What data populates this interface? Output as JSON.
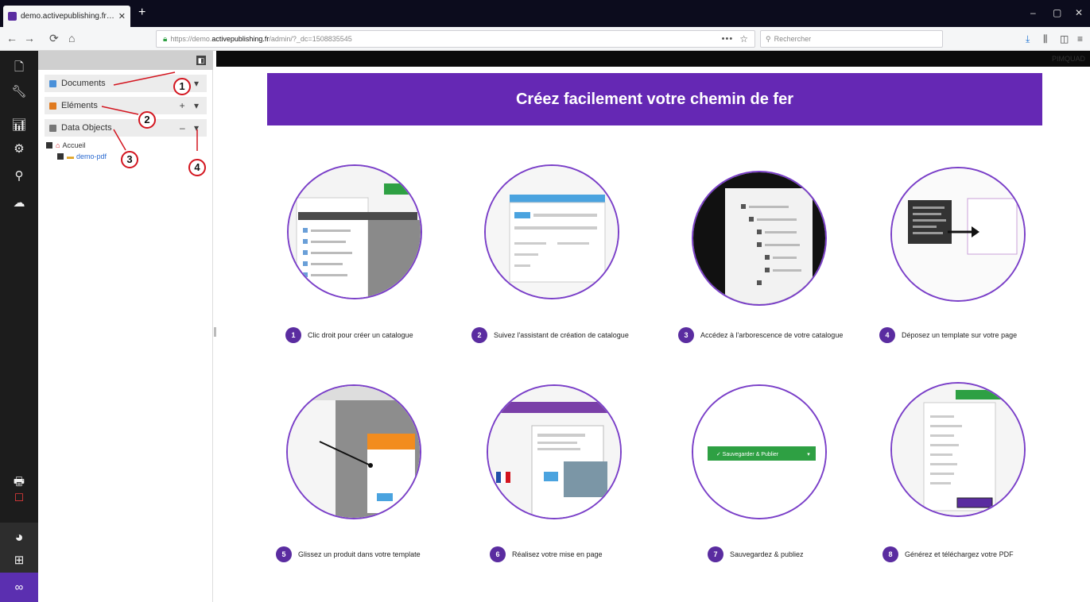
{
  "browser": {
    "tab_title": "demo.activepublishing.fr | P...",
    "tab_close": "✕",
    "new_tab": "+",
    "back": "←",
    "forward": "→",
    "reload": "⟳",
    "home": "⌂",
    "url_prefix": "https://demo.",
    "url_domain": "activepublishing.fr",
    "url_rest": "/admin/?_dc=1508835545",
    "url_actions": "•••",
    "search_placeholder": "Rechercher",
    "minimize": "–",
    "maximize": "▢",
    "close": "✕"
  },
  "sidebar": {
    "collapse_label": "◧",
    "sections": [
      {
        "label": "Documents",
        "controls": "+ ▾",
        "color": "#4a90d9"
      },
      {
        "label": "Eléments",
        "controls": "+ ▾",
        "color": "#e07a1f"
      },
      {
        "label": "Data Objects",
        "controls": "– ▾",
        "color": "#777777"
      }
    ],
    "tree": [
      {
        "label": "Accueil"
      },
      {
        "label": "demo-pdf"
      }
    ],
    "callouts": [
      "1",
      "2",
      "3",
      "4"
    ]
  },
  "main": {
    "brand": "PIMQUAD",
    "banner_title": "Créez facilement votre chemin de fer",
    "steps": [
      {
        "num": "1",
        "label": "Clic droit pour créer un catalogue"
      },
      {
        "num": "2",
        "label": "Suivez l'assistant de création de catalogue"
      },
      {
        "num": "3",
        "label": "Accédez à l'arborescence de votre catalogue"
      },
      {
        "num": "4",
        "label": "Déposez un template sur votre page"
      },
      {
        "num": "5",
        "label": "Glissez un produit dans votre template"
      },
      {
        "num": "6",
        "label": "Réalisez votre mise en page"
      },
      {
        "num": "7",
        "label": "Sauvegardez & publiez"
      },
      {
        "num": "8",
        "label": "Générez et téléchargez votre PDF"
      }
    ],
    "save_publish_button": "✓ Sauvegarder & Publier"
  }
}
